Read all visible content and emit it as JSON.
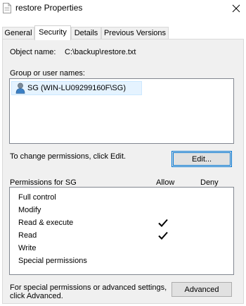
{
  "window": {
    "title": "restore Properties"
  },
  "tabs": [
    {
      "label": "General"
    },
    {
      "label": "Security"
    },
    {
      "label": "Details"
    },
    {
      "label": "Previous Versions"
    }
  ],
  "active_tab": "Security",
  "object": {
    "label": "Object name:",
    "value": "C:\\backup\\restore.txt"
  },
  "groups": {
    "label": "Group or user names:",
    "items": [
      {
        "name": "SG (WIN-LU09299160F\\SG)",
        "icon": "user-icon",
        "selected": true
      }
    ]
  },
  "change_hint": "To change permissions, click Edit.",
  "edit_button": "Edit...",
  "permissions": {
    "title": "Permissions for SG",
    "allow_header": "Allow",
    "deny_header": "Deny",
    "rows": [
      {
        "name": "Full control",
        "allow": false,
        "deny": false
      },
      {
        "name": "Modify",
        "allow": false,
        "deny": false
      },
      {
        "name": "Read & execute",
        "allow": true,
        "deny": false
      },
      {
        "name": "Read",
        "allow": true,
        "deny": false
      },
      {
        "name": "Write",
        "allow": false,
        "deny": false
      },
      {
        "name": "Special permissions",
        "allow": false,
        "deny": false
      }
    ]
  },
  "advanced_hint_line1": "For special permissions or advanced settings,",
  "advanced_hint_line2": "click Advanced.",
  "advanced_button": "Advanced",
  "colors": {
    "selection_bg": "#e5f3ff",
    "focus_border": "#0078d7",
    "button_bg": "#e1e1e1"
  }
}
